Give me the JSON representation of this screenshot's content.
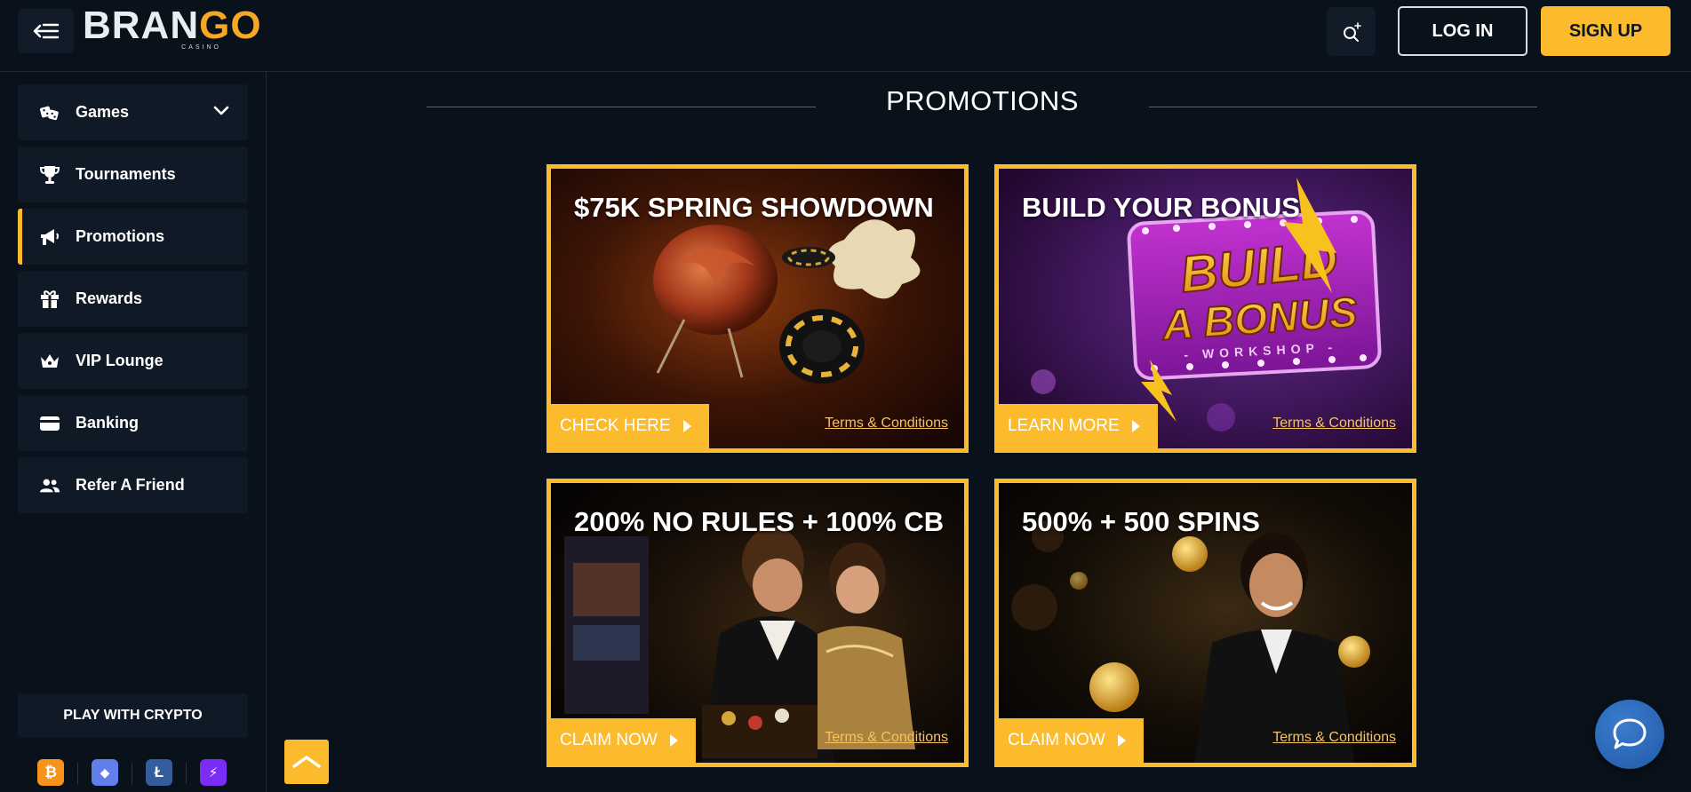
{
  "header": {
    "logo_main_white": "BRAN",
    "logo_main_orange": "GO",
    "logo_sub": "CASINO",
    "login_label": "LOG IN",
    "signup_label": "SIGN UP"
  },
  "sidebar": {
    "items": [
      {
        "label": "Games",
        "icon": "dice-icon"
      },
      {
        "label": "Tournaments",
        "icon": "trophy-icon"
      },
      {
        "label": "Promotions",
        "icon": "megaphone-icon",
        "active": true
      },
      {
        "label": "Rewards",
        "icon": "gift-icon"
      },
      {
        "label": "VIP Lounge",
        "icon": "crown-icon"
      },
      {
        "label": "Banking",
        "icon": "wallet-icon"
      },
      {
        "label": "Refer A Friend",
        "icon": "users-icon"
      }
    ],
    "crypto_label": "PLAY WITH CRYPTO",
    "coins": [
      {
        "name": "bitcoin-icon",
        "symbol": "₿",
        "color": "#f7931a"
      },
      {
        "name": "ethereum-icon",
        "symbol": "◆",
        "color": "#627eea"
      },
      {
        "name": "litecoin-icon",
        "symbol": "Ł",
        "color": "#345d9d"
      },
      {
        "name": "lightning-icon",
        "symbol": "⚡",
        "color": "#7b2cf5"
      }
    ]
  },
  "main": {
    "section_title": "PROMOTIONS",
    "promos": [
      {
        "title": "$75K SPRING SHOWDOWN",
        "cta": "CHECK HERE",
        "terms": "Terms & Conditions"
      },
      {
        "title": "BUILD YOUR BONUS",
        "cta": "LEARN MORE",
        "terms": "Terms & Conditions",
        "art_line1": "BUILD",
        "art_line2": "A BONUS",
        "art_line3": "- WORKSHOP -"
      },
      {
        "title": "200% NO RULES + 100% CB",
        "cta": "CLAIM NOW",
        "terms": "Terms & Conditions"
      },
      {
        "title": "500% + 500 SPINS",
        "cta": "CLAIM NOW",
        "terms": "Terms & Conditions"
      }
    ]
  },
  "colors": {
    "accent": "#fbbb2c",
    "background": "#09111b",
    "panel": "#0f1a26"
  }
}
